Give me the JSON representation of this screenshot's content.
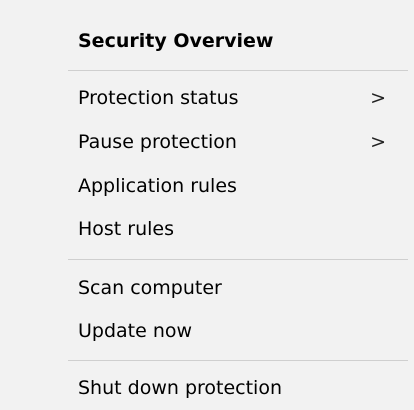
{
  "menu": {
    "header": "Security Overview",
    "items": [
      {
        "label": "Protection status",
        "submenu_icon": ">"
      },
      {
        "label": "Pause protection",
        "submenu_icon": ">"
      },
      {
        "label": "Application rules"
      },
      {
        "label": "Host rules"
      },
      {
        "label": "Scan computer"
      },
      {
        "label": "Update now"
      },
      {
        "label": "Shut down protection"
      }
    ]
  }
}
